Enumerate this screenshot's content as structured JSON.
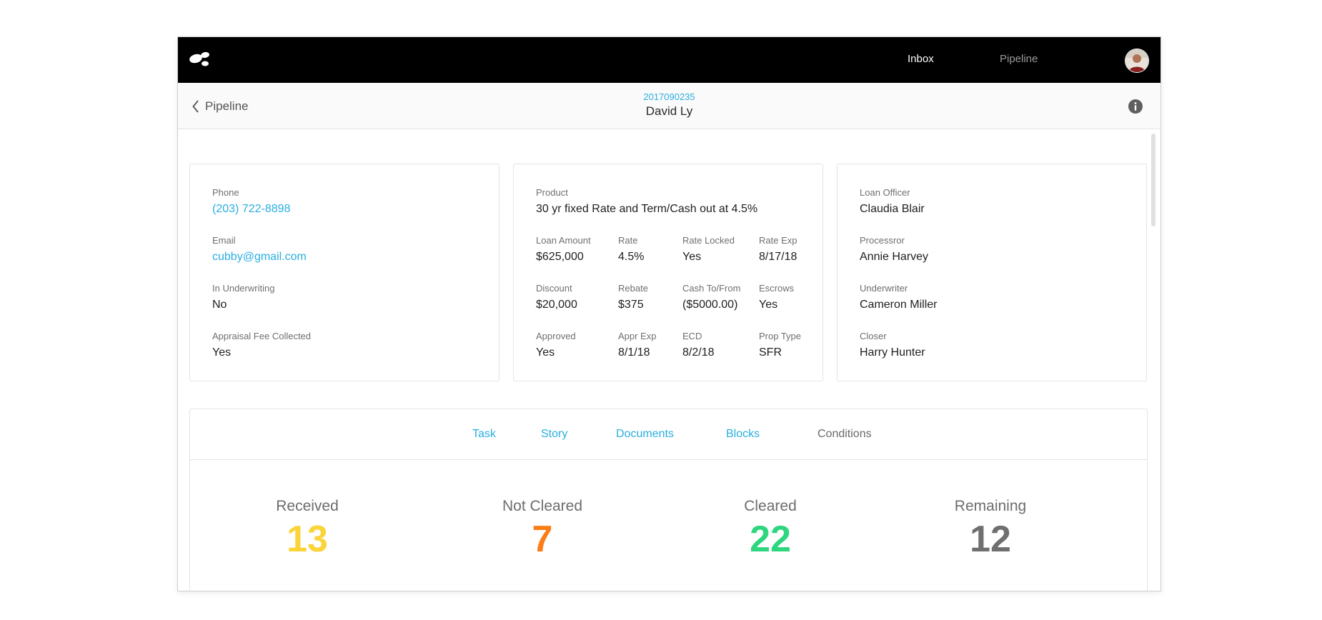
{
  "nav": {
    "logo": "logo-icon",
    "items": [
      {
        "label": "Inbox",
        "active": true
      },
      {
        "label": "Pipeline",
        "active": false
      }
    ],
    "avatar": "user-avatar"
  },
  "subheader": {
    "back_label": "Pipeline",
    "loan_number": "2017090235",
    "borrower_name": "David Ly",
    "info_icon": "info-icon"
  },
  "contact": {
    "phone": {
      "label": "Phone",
      "value": "(203) 722-8898"
    },
    "email": {
      "label": "Email",
      "value": "cubby@gmail.com"
    },
    "underwriting": {
      "label": "In Underwriting",
      "value": "No"
    },
    "appraisal": {
      "label": "Appraisal Fee Collected",
      "value": "Yes"
    }
  },
  "loan": {
    "product": {
      "label": "Product",
      "value": "30 yr fixed Rate and Term/Cash out at 4.5%"
    },
    "loan_amount": {
      "label": "Loan Amount",
      "value": "$625,000"
    },
    "rate": {
      "label": "Rate",
      "value": "4.5%"
    },
    "rate_locked": {
      "label": "Rate Locked",
      "value": "Yes"
    },
    "rate_exp": {
      "label": "Rate Exp",
      "value": "8/17/18"
    },
    "discount": {
      "label": "Discount",
      "value": "$20,000"
    },
    "rebate": {
      "label": "Rebate",
      "value": "$375"
    },
    "cash": {
      "label": "Cash To/From",
      "value": "($5000.00)"
    },
    "escrows": {
      "label": "Escrows",
      "value": "Yes"
    },
    "approved": {
      "label": "Approved",
      "value": "Yes"
    },
    "appr_exp": {
      "label": "Appr Exp",
      "value": "8/1/18"
    },
    "ecd": {
      "label": "ECD",
      "value": "8/2/18"
    },
    "prop_type": {
      "label": "Prop Type",
      "value": "SFR"
    }
  },
  "team": {
    "loan_officer": {
      "label": "Loan Officer",
      "value": "Claudia Blair"
    },
    "processor": {
      "label": "Processror",
      "value": "Annie Harvey"
    },
    "underwriter": {
      "label": "Underwriter",
      "value": "Cameron Miller"
    },
    "closer": {
      "label": "Closer",
      "value": "Harry Hunter"
    }
  },
  "tabs": [
    {
      "label": "Task",
      "active": false
    },
    {
      "label": "Story",
      "active": false
    },
    {
      "label": "Documents",
      "active": false
    },
    {
      "label": "Blocks",
      "active": false
    },
    {
      "label": "Conditions",
      "active": true
    }
  ],
  "stats": [
    {
      "label": "Received",
      "value": "13",
      "color": "#fbd43a"
    },
    {
      "label": "Not Cleared",
      "value": "7",
      "color": "#fb7d18"
    },
    {
      "label": "Cleared",
      "value": "22",
      "color": "#2ed67f"
    },
    {
      "label": "Remaining",
      "value": "12",
      "color": "#6f6f6f"
    }
  ],
  "colors": {
    "accent": "#2aaee0",
    "topbar": "#000000",
    "received": "#fbd43a",
    "not_cleared": "#fb7d18",
    "cleared": "#2ed67f",
    "remaining": "#6f6f6f"
  }
}
